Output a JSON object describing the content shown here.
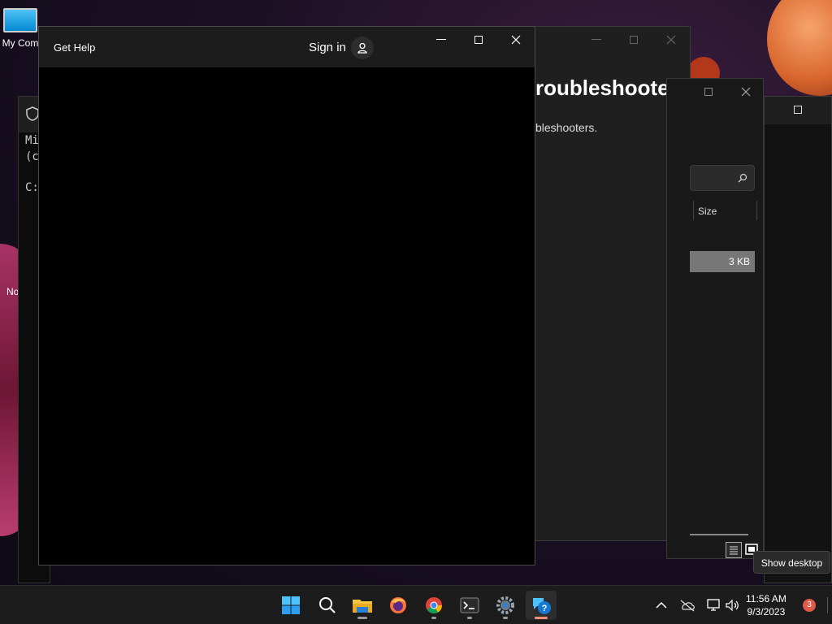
{
  "desktop": {
    "icons": [
      {
        "label": "My Com"
      },
      {
        "label": "No"
      }
    ]
  },
  "terminal": {
    "lines": [
      "Mi",
      "(c",
      "C:"
    ]
  },
  "troubleshooter": {
    "heading": "roubleshoote",
    "subtitle": "bleshooters."
  },
  "explorer": {
    "column_size": "Size",
    "row_size": "3 KB"
  },
  "get_help": {
    "title": "Get Help",
    "sign_in": "Sign in"
  },
  "tooltip": {
    "text": "Show desktop"
  },
  "taskbar": {
    "apps": [
      "start-icon",
      "search-icon",
      "file-explorer-icon",
      "firefox-icon",
      "chrome-icon",
      "terminal-icon",
      "settings-icon",
      "get-help-icon"
    ],
    "time": "11:56 AM",
    "date": "9/3/2023",
    "notification_count": "3"
  },
  "colors": {
    "taskbar_bg": "#1c1c1c",
    "window_bg": "#202020",
    "accent": "#0078d4"
  }
}
